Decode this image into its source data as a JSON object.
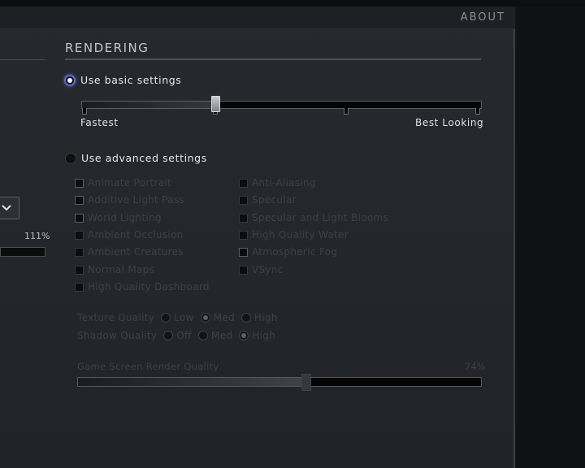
{
  "header": {
    "about": "ABOUT"
  },
  "left": {
    "percent": "111%"
  },
  "rendering": {
    "title": "RENDERING",
    "basic": {
      "label": "Use basic settings",
      "selected": true,
      "fastest": "Fastest",
      "best": "Best Looking"
    },
    "advanced": {
      "label": "Use advanced settings",
      "selected": false
    },
    "checkboxes_left": [
      "Animate Portrait",
      "Additive Light Pass",
      "World Lighting",
      "Ambient Occlusion",
      "Ambient Creatures",
      "Normal Maps",
      "High Quality Dashboard"
    ],
    "checkboxes_right": [
      "Anti-Aliasing",
      "Specular",
      "Specular and Light Blooms",
      "High Quality Water",
      "Atmospheric Fog",
      "VSync"
    ],
    "texture": {
      "label": "Texture Quality",
      "options": [
        "Low",
        "Med",
        "High"
      ],
      "selected": "Med"
    },
    "shadow": {
      "label": "Shadow Quality",
      "options": [
        "Off",
        "Med",
        "High"
      ],
      "selected": "High"
    },
    "render_quality": {
      "label": "Game Screen Render Quality",
      "percent": "74%",
      "value": 0.74
    }
  }
}
